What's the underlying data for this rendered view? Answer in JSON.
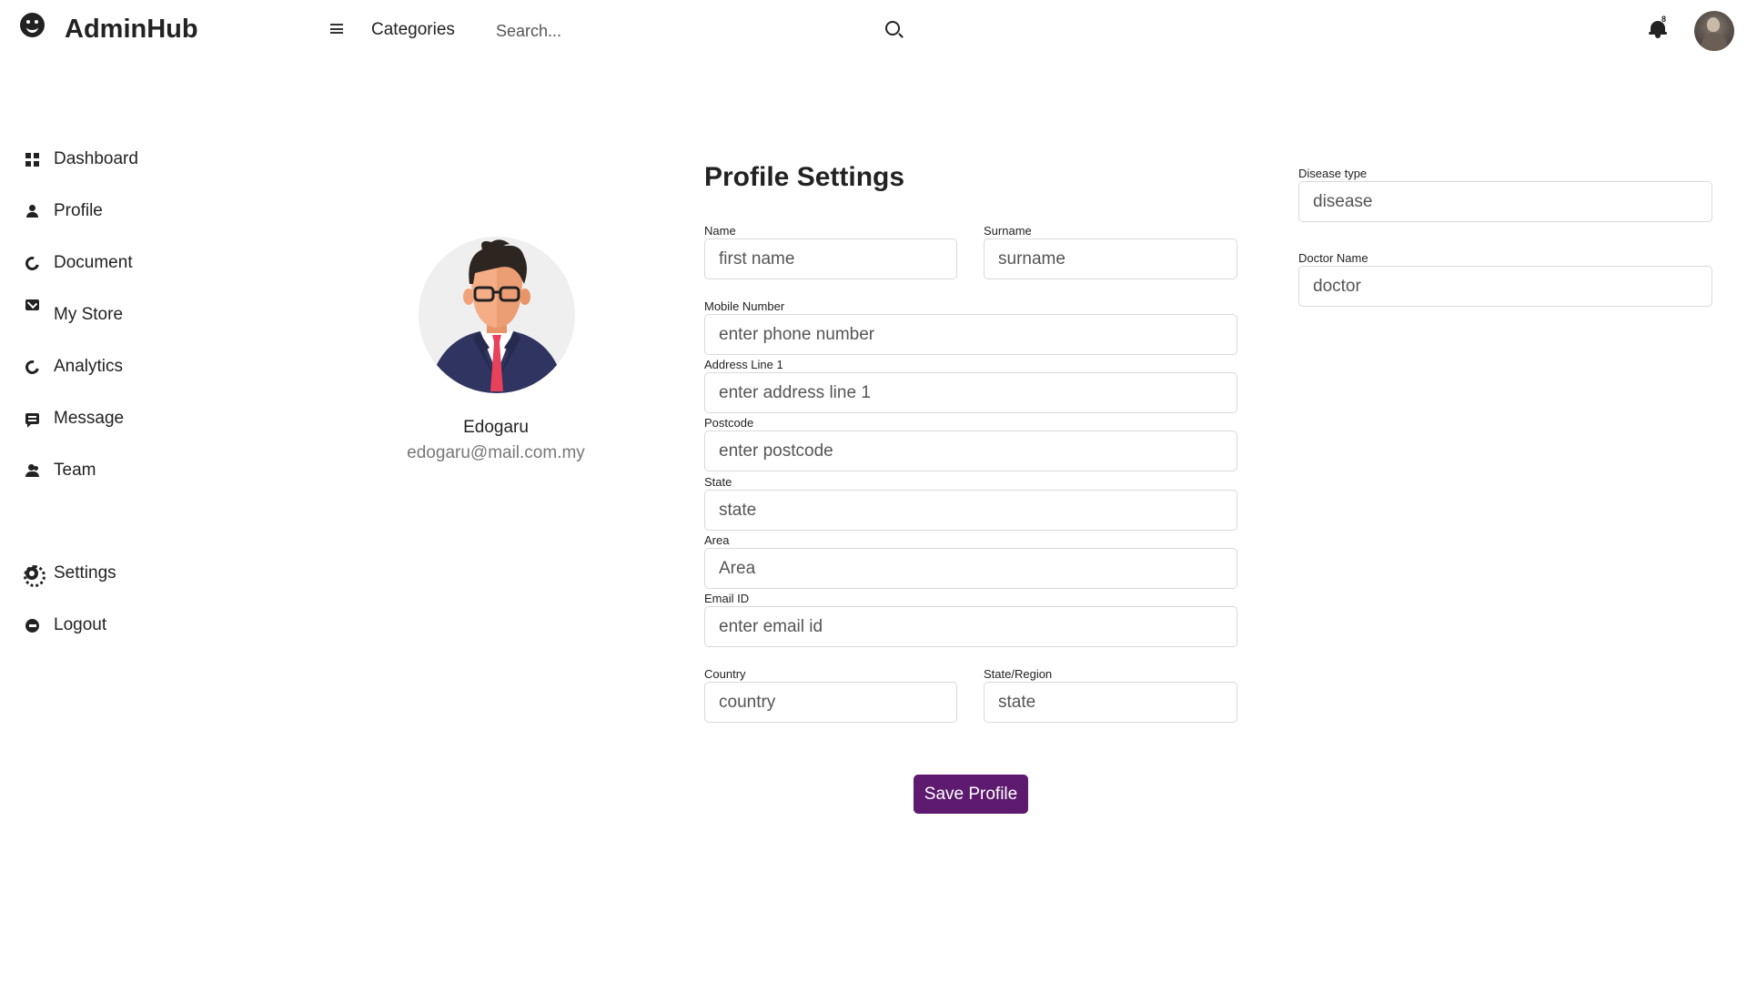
{
  "header": {
    "brand": "AdminHub",
    "categories_label": "Categories",
    "search_placeholder": "Search...",
    "notification_count": "8"
  },
  "sidebar": {
    "items": [
      {
        "label": "Dashboard",
        "icon": "dashboard-icon"
      },
      {
        "label": "Profile",
        "icon": "person-icon"
      },
      {
        "label": "Document",
        "icon": "document-icon"
      },
      {
        "label": "My Store",
        "icon": "store-icon"
      },
      {
        "label": "Analytics",
        "icon": "analytics-icon"
      },
      {
        "label": "Message",
        "icon": "message-icon"
      },
      {
        "label": "Team",
        "icon": "team-icon"
      }
    ],
    "bottom_items": [
      {
        "label": "Settings",
        "icon": "gear-icon"
      },
      {
        "label": "Logout",
        "icon": "logout-icon"
      }
    ]
  },
  "profile": {
    "name": "Edogaru",
    "email": "edogaru@mail.com.my"
  },
  "form": {
    "title": "Profile Settings",
    "fields": {
      "name": {
        "label": "Name",
        "placeholder": "first name"
      },
      "surname": {
        "label": "Surname",
        "placeholder": "surname"
      },
      "mobile": {
        "label": "Mobile Number",
        "placeholder": "enter phone number"
      },
      "address1": {
        "label": "Address Line 1",
        "placeholder": "enter address line 1"
      },
      "postcode": {
        "label": "Postcode",
        "placeholder": "enter postcode"
      },
      "state": {
        "label": "State",
        "placeholder": "state"
      },
      "area": {
        "label": "Area",
        "placeholder": "Area"
      },
      "email": {
        "label": "Email ID",
        "placeholder": "enter email id"
      },
      "country": {
        "label": "Country",
        "placeholder": "country"
      },
      "region": {
        "label": "State/Region",
        "placeholder": "state"
      },
      "disease": {
        "label": "Disease type",
        "placeholder": "disease"
      },
      "doctor": {
        "label": "Doctor Name",
        "placeholder": "doctor"
      }
    },
    "save_label": "Save Profile"
  },
  "colors": {
    "accent": "#5d1a6f",
    "text": "#222222",
    "muted": "#777777",
    "border": "#d9d9d9"
  }
}
